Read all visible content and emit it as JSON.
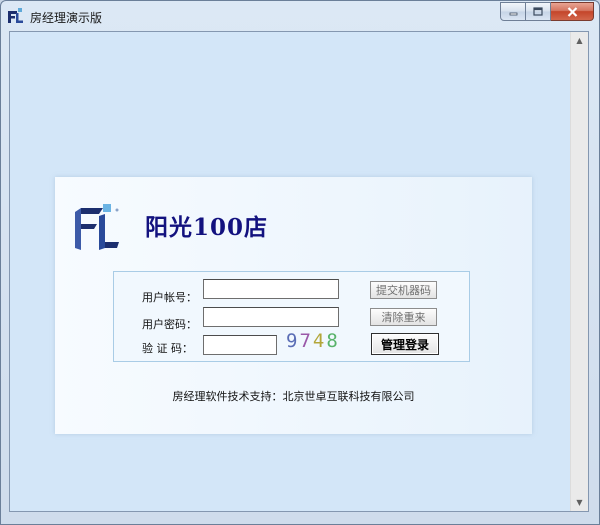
{
  "window": {
    "title": "房经理演示版"
  },
  "brand": {
    "name": "阳光100店",
    "color": "#13127f"
  },
  "form": {
    "account_label": "用户帐号：",
    "account_value": "",
    "password_label": "用户密码：",
    "password_value": "",
    "captcha_label": "验 证 码：",
    "captcha_value": "",
    "captcha_digits": [
      {
        "ch": "9",
        "color": "#5a6db5"
      },
      {
        "ch": "7",
        "color": "#9a58a8"
      },
      {
        "ch": "4",
        "color": "#b3a63a"
      },
      {
        "ch": "8",
        "color": "#59b36a"
      }
    ]
  },
  "buttons": {
    "submit_machine_code": "提交机器码",
    "clear_reset": "清除重来",
    "admin_login": "管理登录"
  },
  "footer": {
    "support_text": "房经理软件技术支持：北京世卓互联科技有限公司"
  },
  "icons": {
    "app": "fl-logo-icon",
    "minimize": "minimize-icon",
    "maximize": "maximize-icon",
    "close": "close-icon",
    "scroll_up": "scroll-up-arrow-icon",
    "scroll_down": "scroll-down-arrow-icon"
  }
}
